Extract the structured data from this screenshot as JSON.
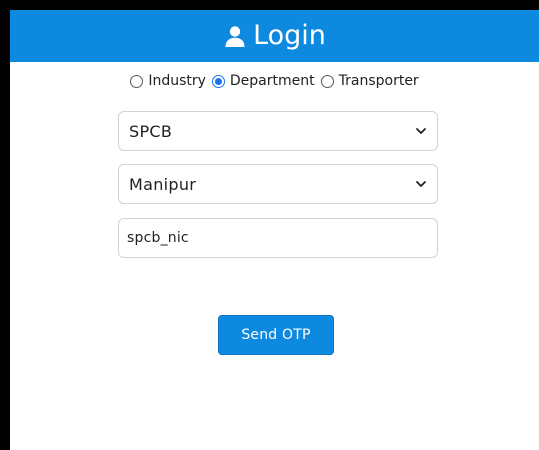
{
  "header": {
    "title": "Login",
    "icon": "user-icon",
    "background": "#0d89e0"
  },
  "login_type": {
    "options": [
      {
        "label": "Industry",
        "checked": false
      },
      {
        "label": "Department",
        "checked": true
      },
      {
        "label": "Transporter",
        "checked": false
      }
    ]
  },
  "form": {
    "department_select": {
      "value": "SPCB"
    },
    "state_select": {
      "value": "Manipur"
    },
    "username": {
      "value": "spcb_nic"
    }
  },
  "actions": {
    "send_otp_label": "Send OTP",
    "button_color": "#0d89e0"
  }
}
